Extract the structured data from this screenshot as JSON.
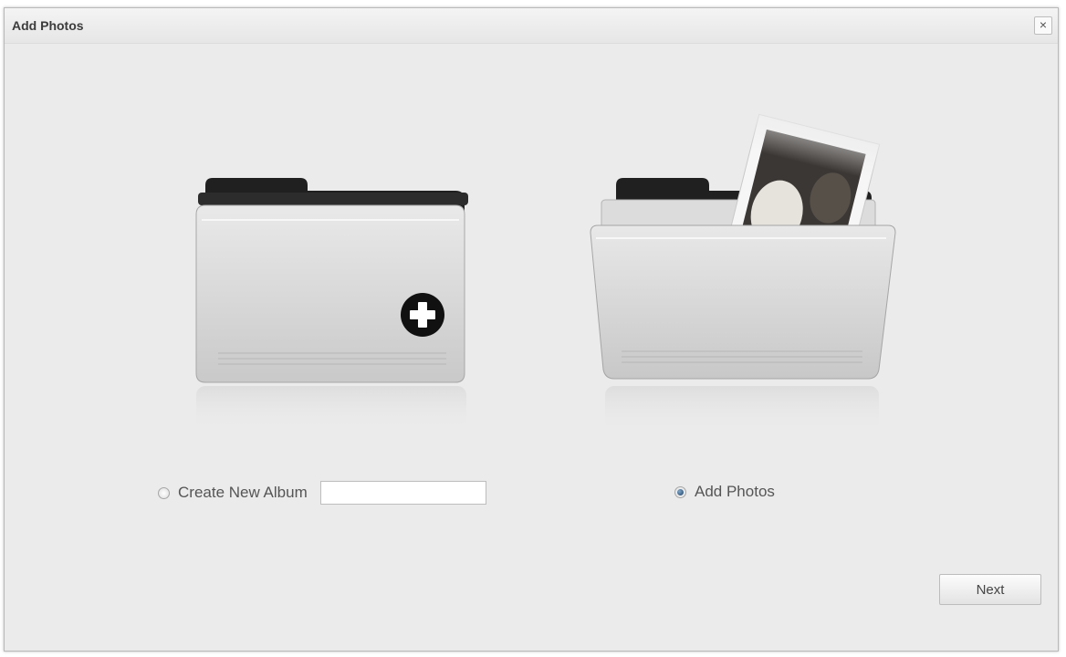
{
  "dialog": {
    "title": "Add Photos",
    "close_label": "×"
  },
  "options": {
    "create_album": {
      "label": "Create New Album",
      "selected": false,
      "input_value": "",
      "input_placeholder": ""
    },
    "add_photos": {
      "label": "Add Photos",
      "selected": true
    }
  },
  "actions": {
    "next_label": "Next"
  },
  "icons": {
    "left_folder": "folder-plus-icon",
    "right_folder": "folder-photo-icon"
  },
  "colors": {
    "dialog_bg": "#ebebeb",
    "folder_tab": "#1e1e1e",
    "radio_checked": "#1d3f66"
  }
}
